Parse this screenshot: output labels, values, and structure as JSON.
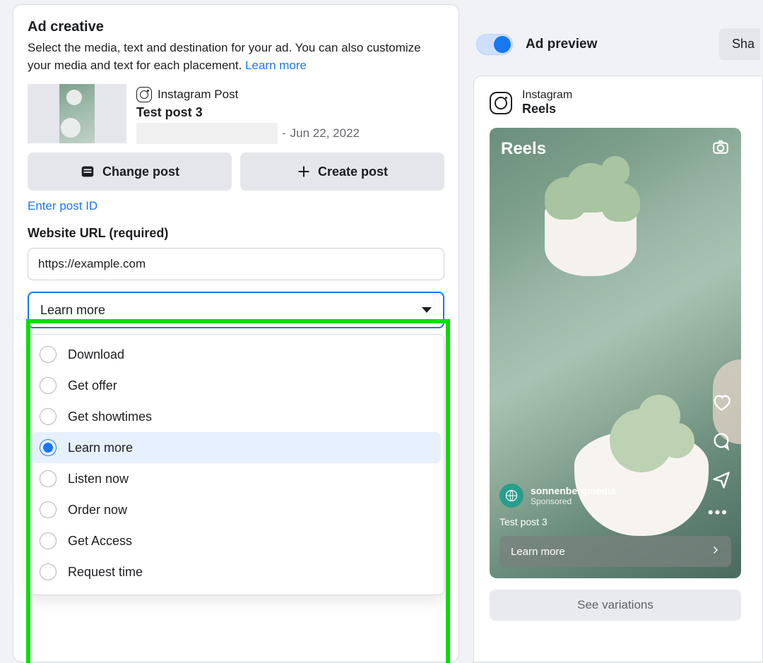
{
  "creative": {
    "title": "Ad creative",
    "description_part1": "Select the media, text and destination for your ad. You can also customize your media and text for each placement. ",
    "learn_more": "Learn more",
    "post_source": "Instagram Post",
    "post_title": "Test post 3",
    "post_date_sep": "-",
    "post_date": "Jun 22, 2022",
    "change_post": "Change post",
    "create_post": "Create post",
    "enter_post_id": "Enter post ID",
    "url_label": "Website URL (required)",
    "url_value": "https://example.com"
  },
  "cta_select": {
    "selected": "Learn more",
    "options": [
      {
        "label": "Download",
        "selected": false
      },
      {
        "label": "Get offer",
        "selected": false
      },
      {
        "label": "Get showtimes",
        "selected": false
      },
      {
        "label": "Learn more",
        "selected": true
      },
      {
        "label": "Listen now",
        "selected": false
      },
      {
        "label": "Order now",
        "selected": false
      },
      {
        "label": "Get Access",
        "selected": false
      },
      {
        "label": "Request time",
        "selected": false
      }
    ]
  },
  "preview": {
    "toggle_label": "Ad preview",
    "share": "Sha",
    "platform": "Instagram",
    "placement": "Reels",
    "reels_label": "Reels",
    "username": "sonnenbergmedia",
    "sponsored": "Sponsored",
    "caption": "Test post 3",
    "cta": "Learn more",
    "see_variations": "See variations",
    "more_dots": "•••"
  }
}
